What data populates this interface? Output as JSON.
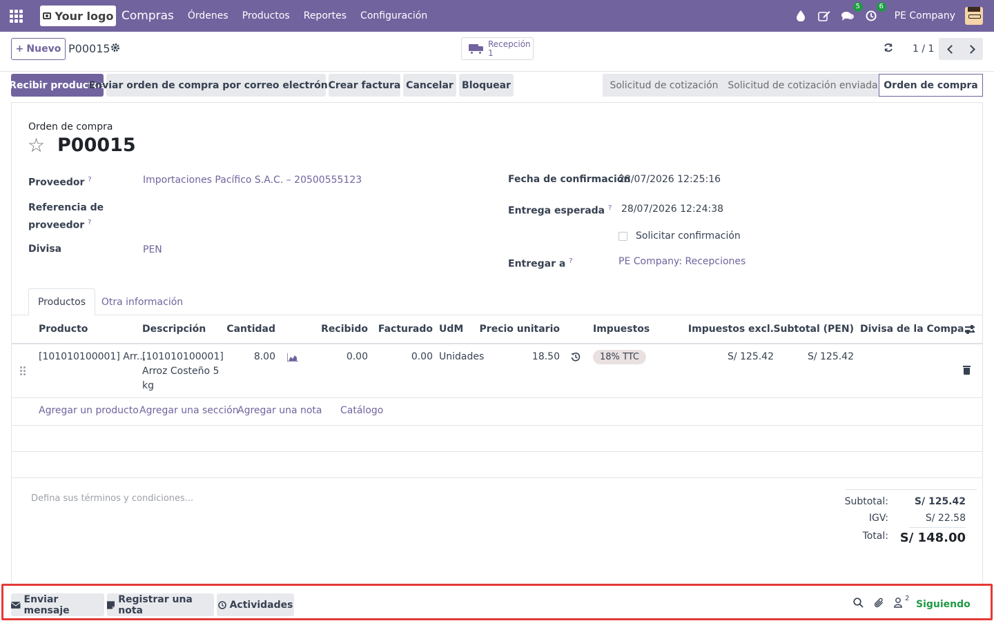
{
  "navbar": {
    "logo_text": "Your logo",
    "app_name": "Compras",
    "menu": [
      "Órdenes",
      "Productos",
      "Reportes",
      "Configuración"
    ],
    "messages_count": "5",
    "activities_count": "6",
    "company": "PE Company"
  },
  "control": {
    "new_label": "Nuevo",
    "record_name": "P00015",
    "smart_button": {
      "label": "Recepción",
      "value": "1"
    },
    "pager": "1 / 1"
  },
  "statusbar": {
    "actions": [
      "Recibir productos",
      "Enviar orden de compra por correo electrónico",
      "Crear factura",
      "Cancelar",
      "Bloquear"
    ],
    "stages": [
      "Solicitud de cotización",
      "Solicitud de cotización enviada",
      "Orden de compra"
    ],
    "active_stage": "Orden de compra"
  },
  "form": {
    "header_label": "Orden de compra",
    "title": "P00015",
    "proveedor_label": "Proveedor",
    "proveedor_value": "Importaciones Pacífico S.A.C. – 20500555123",
    "referencia_label_1": "Referencia de",
    "referencia_label_2": "proveedor",
    "divisa_label": "Divisa",
    "divisa_value": "PEN",
    "fecha_conf_label": "Fecha de confirmación",
    "fecha_conf_value": "28/07/2026 12:25:16",
    "entrega_label": "Entrega esperada",
    "entrega_value": "28/07/2026 12:24:38",
    "solicitar_label": "Solicitar confirmación",
    "entregar_label": "Entregar a",
    "entregar_value": "PE Company: Recepciones",
    "help_mark": "?"
  },
  "tabs": [
    "Productos",
    "Otra información"
  ],
  "table": {
    "columns": [
      "Producto",
      "Descripción",
      "Cantidad",
      "Recibido",
      "Facturado",
      "UdM",
      "Precio unitario",
      "Impuestos",
      "Impuestos excl.",
      "Subtotal (PEN)",
      "Divisa de la Compa..."
    ],
    "row": {
      "producto": "[101010100001] Arr...",
      "descripcion_1": "[101010100001]",
      "descripcion_2": "Arroz Costeño 5",
      "descripcion_3": "kg",
      "cantidad": "8.00",
      "recibido": "0.00",
      "facturado": "0.00",
      "udm": "Unidades",
      "precio": "18.50",
      "impuesto": "18% TTC",
      "impuestos_excl": "S/ 125.42",
      "subtotal": "S/ 125.42"
    },
    "add_links": [
      "Agregar un producto",
      "Agregar una sección",
      "Agregar una nota",
      "Catálogo"
    ]
  },
  "terms_placeholder": "Defina sus términos y condiciones...",
  "totals": {
    "subtotal_label": "Subtotal:",
    "subtotal_value": "S/ 125.42",
    "igv_label": "IGV:",
    "igv_value": "S/ 22.58",
    "total_label": "Total:",
    "total_value": "S/ 148.00"
  },
  "chatter": {
    "send_message": "Enviar mensaje",
    "log_note": "Registrar una nota",
    "activities": "Actividades",
    "followers_count": "2",
    "following": "Siguiendo"
  },
  "colors": {
    "brand": "#71639e",
    "following": "#1f9a45",
    "highlight": "#e53935"
  }
}
